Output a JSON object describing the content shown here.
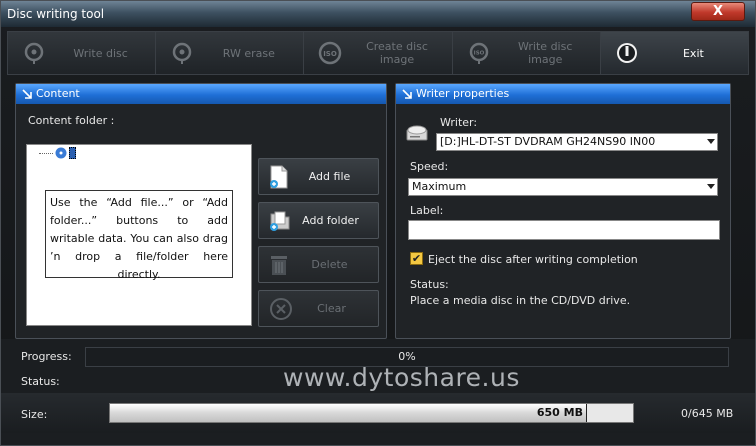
{
  "window": {
    "title": "Disc writing tool",
    "close_label": "X"
  },
  "toolbar": [
    {
      "label": "Write disc",
      "icon": "disc-pin-icon",
      "enabled": false
    },
    {
      "label": "RW erase",
      "icon": "disc-pin-icon",
      "enabled": false
    },
    {
      "label": "Create disc image",
      "icon": "iso-icon",
      "enabled": false
    },
    {
      "label": "Write disc image",
      "icon": "iso-pin-icon",
      "enabled": false
    },
    {
      "label": "Exit",
      "icon": "power-icon",
      "enabled": true
    }
  ],
  "content_panel": {
    "title": "Content",
    "folder_label": "Content folder :",
    "hint": "Use the “Add file...” or “Add folder...” buttons to add writable data. You can also drag ’n drop a file/folder here directly.",
    "buttons": {
      "add_file": "Add file",
      "add_folder": "Add folder",
      "delete": "Delete",
      "clear": "Clear"
    }
  },
  "writer_panel": {
    "title": "Writer properties",
    "writer_label": "Writer:",
    "writer_value": "[D:]HL-DT-ST DVDRAM GH24NS90  IN00",
    "speed_label": "Speed:",
    "speed_value": "Maximum",
    "label_label": "Label:",
    "label_value": "",
    "eject_label": "Eject the disc after writing completion",
    "eject_checked": true,
    "status_label": "Status:",
    "status_text": "Place a media disc in the CD/DVD drive."
  },
  "footer": {
    "progress_label": "Progress:",
    "progress_text": "0%",
    "progress_fraction": 0,
    "status_label": "Status:",
    "size_label": "Size:",
    "size_value": "650 MB",
    "size_total": "0/645  MB",
    "watermark": "www.dytoshare.us"
  },
  "colors": {
    "header_blue": "#1f6fd6",
    "checkbox": "#f4c842",
    "close_red": "#c0392b"
  }
}
